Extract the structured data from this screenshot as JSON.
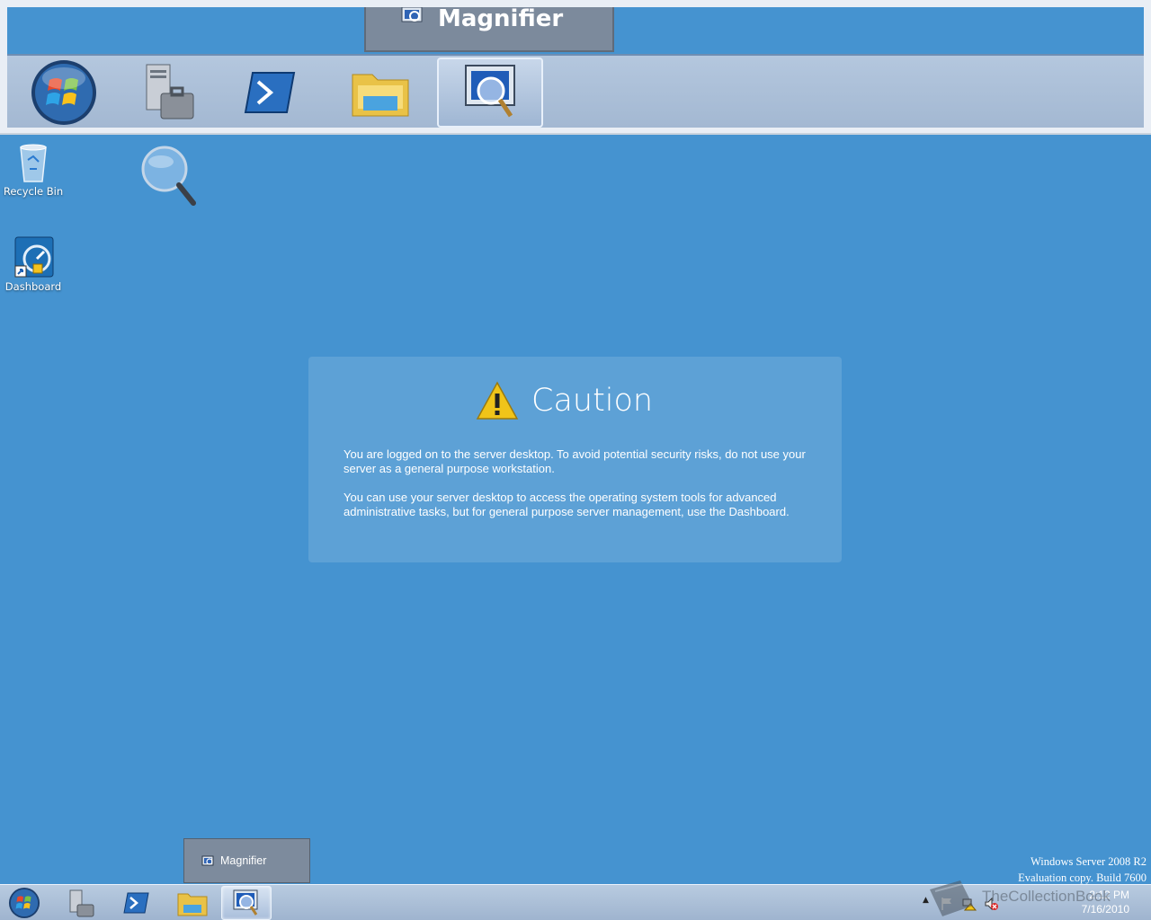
{
  "magnifier_lens": {
    "preview_label": "Magnifier",
    "buttons": [
      {
        "name": "start-orb",
        "active": false
      },
      {
        "name": "server-manager",
        "active": false
      },
      {
        "name": "powershell",
        "active": false
      },
      {
        "name": "explorer",
        "active": false
      },
      {
        "name": "magnifier",
        "active": true
      }
    ]
  },
  "desktop": {
    "icons": [
      {
        "label": "Recycle Bin",
        "icon": "recycle-bin-icon"
      },
      {
        "label": "Dashboard",
        "icon": "dashboard-icon"
      }
    ],
    "magnifier_glass": "magnifier-glass-icon"
  },
  "caution": {
    "title": "Caution",
    "paragraph1": "You are logged on to the server desktop. To avoid potential security risks, do not use your server as a general purpose workstation.",
    "paragraph2": "You can use your server desktop to access the operating system tools for advanced administrative tasks, but for general purpose server management, use the Dashboard."
  },
  "taskbar": {
    "thumbnail_label": "Magnifier",
    "clock_time": "2:12 PM",
    "clock_date": "7/16/2010",
    "pinned": [
      "server-manager",
      "powershell",
      "explorer",
      "magnifier"
    ]
  },
  "watermark": {
    "line1": "Windows Server 2008 R2",
    "line2": "Evaluation copy. Build 7600",
    "site": "TheCollectionBook"
  },
  "colors": {
    "desktop": "#4593d0",
    "taskbar": "#a9bdd6",
    "caution_triangle": "#f0c419"
  }
}
